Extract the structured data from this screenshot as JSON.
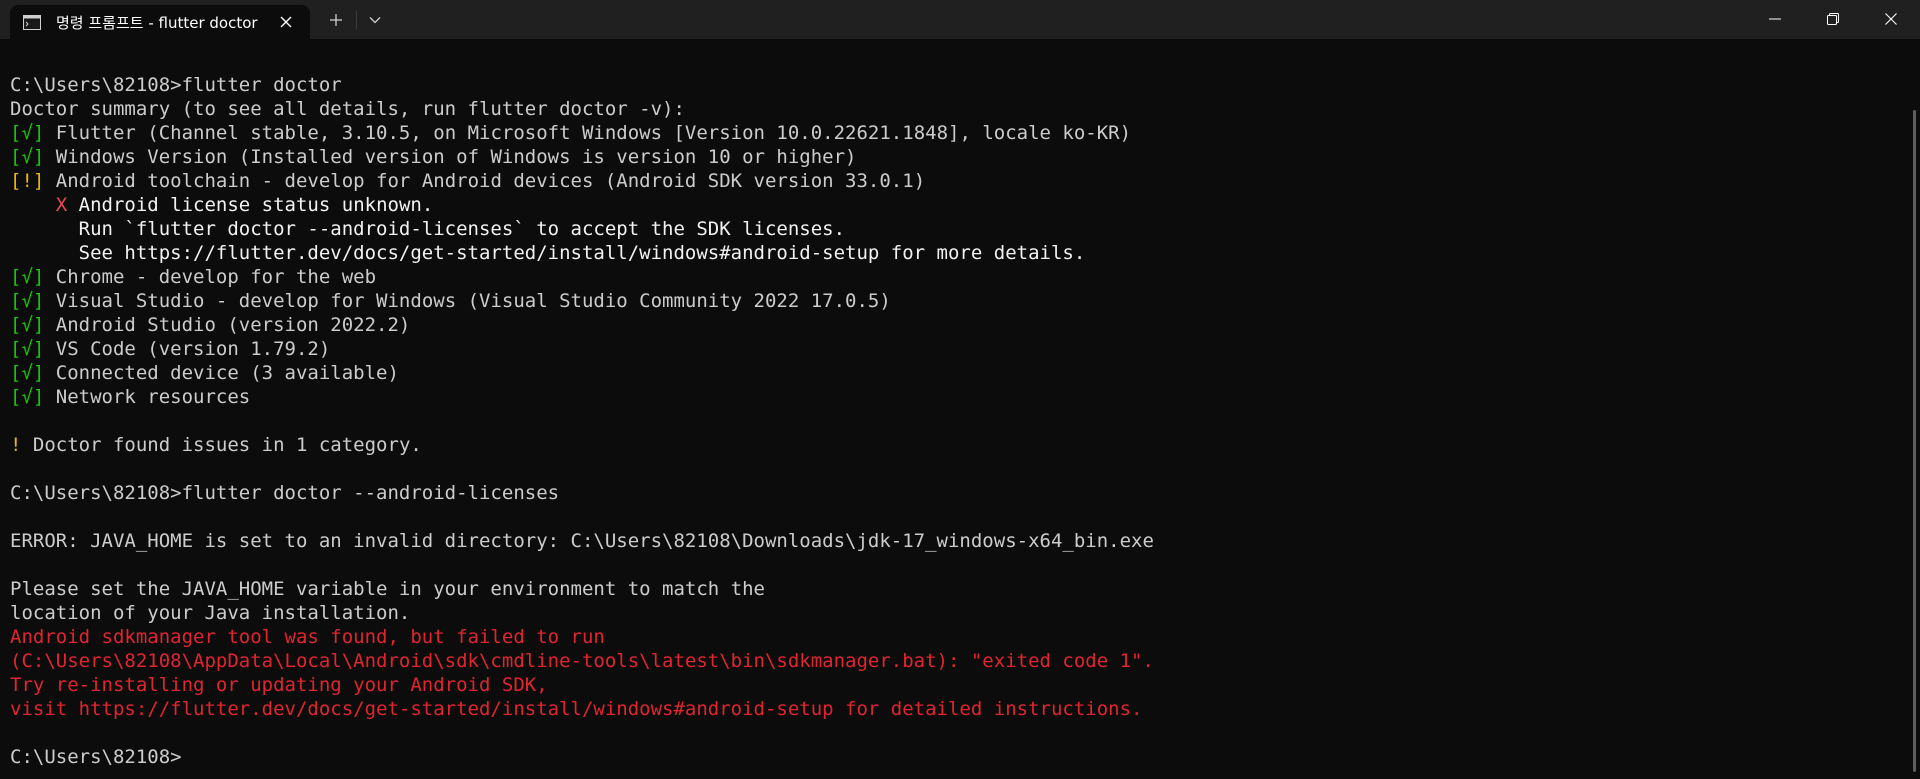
{
  "window": {
    "tab_title": "명령 프롬프트 - flutter  doctor",
    "new_tab_symbol": "+",
    "colors": {
      "background": "#0c0c0c",
      "titlebar": "#202020",
      "text": "#cccccc",
      "ok": "#16c60c",
      "warn": "#e5b710",
      "error": "#e0252f"
    }
  },
  "terminal": {
    "lines": [
      {
        "segments": [
          {
            "text": "C:\\Users\\82108>flutter doctor",
            "cls": ""
          }
        ]
      },
      {
        "segments": [
          {
            "text": "Doctor summary (to see all details, run flutter doctor -v):",
            "cls": ""
          }
        ]
      },
      {
        "segments": [
          {
            "text": "[√]",
            "cls": "ok"
          },
          {
            "text": " Flutter (Channel stable, 3.10.5, on Microsoft Windows [Version 10.0.22621.1848], locale ko-KR)",
            "cls": ""
          }
        ]
      },
      {
        "segments": [
          {
            "text": "[√]",
            "cls": "ok"
          },
          {
            "text": " Windows Version (Installed version of Windows is version 10 or higher)",
            "cls": ""
          }
        ]
      },
      {
        "segments": [
          {
            "text": "[!]",
            "cls": "warn"
          },
          {
            "text": " Android toolchain - develop for Android devices (Android SDK version 33.0.1)",
            "cls": ""
          }
        ]
      },
      {
        "segments": [
          {
            "text": "    ",
            "cls": ""
          },
          {
            "text": "X",
            "cls": "x"
          },
          {
            "text": " Android license status unknown.",
            "cls": "bright"
          }
        ]
      },
      {
        "segments": [
          {
            "text": "      Run `flutter doctor --android-licenses` to accept the SDK licenses.",
            "cls": "bright"
          }
        ]
      },
      {
        "segments": [
          {
            "text": "      See https://flutter.dev/docs/get-started/install/windows#android-setup for more details.",
            "cls": "bright"
          }
        ]
      },
      {
        "segments": [
          {
            "text": "[√]",
            "cls": "ok"
          },
          {
            "text": " Chrome - develop for the web",
            "cls": ""
          }
        ]
      },
      {
        "segments": [
          {
            "text": "[√]",
            "cls": "ok"
          },
          {
            "text": " Visual Studio - develop for Windows (Visual Studio Community 2022 17.0.5)",
            "cls": ""
          }
        ]
      },
      {
        "segments": [
          {
            "text": "[√]",
            "cls": "ok"
          },
          {
            "text": " Android Studio (version 2022.2)",
            "cls": ""
          }
        ]
      },
      {
        "segments": [
          {
            "text": "[√]",
            "cls": "ok"
          },
          {
            "text": " VS Code (version 1.79.2)",
            "cls": ""
          }
        ]
      },
      {
        "segments": [
          {
            "text": "[√]",
            "cls": "ok"
          },
          {
            "text": " Connected device (3 available)",
            "cls": ""
          }
        ]
      },
      {
        "segments": [
          {
            "text": "[√]",
            "cls": "ok"
          },
          {
            "text": " Network resources",
            "cls": ""
          }
        ]
      },
      {
        "segments": []
      },
      {
        "segments": [
          {
            "text": "!",
            "cls": "warn"
          },
          {
            "text": " Doctor found issues in 1 category.",
            "cls": ""
          }
        ]
      },
      {
        "segments": []
      },
      {
        "segments": [
          {
            "text": "C:\\Users\\82108>flutter doctor --android-licenses",
            "cls": ""
          }
        ]
      },
      {
        "segments": []
      },
      {
        "segments": [
          {
            "text": "ERROR: JAVA_HOME is set to an invalid directory: C:\\Users\\82108\\Downloads\\jdk-17_windows-x64_bin.exe",
            "cls": ""
          }
        ]
      },
      {
        "segments": []
      },
      {
        "segments": [
          {
            "text": "Please set the JAVA_HOME variable in your environment to match the",
            "cls": ""
          }
        ]
      },
      {
        "segments": [
          {
            "text": "location of your Java installation.",
            "cls": ""
          }
        ]
      },
      {
        "segments": [
          {
            "text": "Android sdkmanager tool was found, but failed to run",
            "cls": "red"
          }
        ]
      },
      {
        "segments": [
          {
            "text": "(C:\\Users\\82108\\AppData\\Local\\Android\\sdk\\cmdline-tools\\latest\\bin\\sdkmanager.bat): \"exited code 1\".",
            "cls": "red"
          }
        ]
      },
      {
        "segments": [
          {
            "text": "Try re-installing or updating your Android SDK,",
            "cls": "red"
          }
        ]
      },
      {
        "segments": [
          {
            "text": "visit https://flutter.dev/docs/get-started/install/windows#android-setup for detailed instructions.",
            "cls": "red"
          }
        ]
      },
      {
        "segments": []
      },
      {
        "segments": [
          {
            "text": "C:\\Users\\82108>",
            "cls": ""
          }
        ]
      }
    ]
  }
}
